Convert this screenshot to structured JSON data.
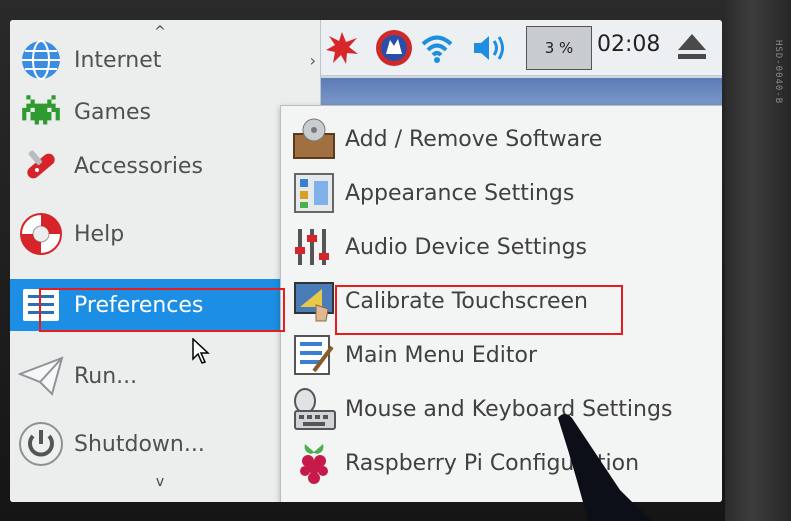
{
  "device": {
    "pcb_label": "HSD-0040-B"
  },
  "taskbar": {
    "cpu_label": "3 %",
    "clock": "02:08",
    "icons": [
      "burst-icon",
      "wolf-icon",
      "wifi-icon",
      "volume-icon",
      "eject-icon"
    ]
  },
  "main_menu": {
    "scroll_up": "^",
    "scroll_down": "v",
    "items": [
      {
        "label": "Internet",
        "icon": "globe-icon"
      },
      {
        "label": "Games",
        "icon": "space-invader-icon"
      },
      {
        "label": "Accessories",
        "icon": "knife-icon"
      },
      {
        "label": "Help",
        "icon": "lifebuoy-icon"
      },
      {
        "label": "Preferences",
        "icon": "preferences-icon"
      },
      {
        "label": "Run...",
        "icon": "paper-plane-icon"
      },
      {
        "label": "Shutdown...",
        "icon": "power-icon"
      }
    ],
    "arrow": "›"
  },
  "submenu": {
    "items": [
      {
        "label": "Add / Remove Software",
        "icon": "package-icon"
      },
      {
        "label": "Appearance Settings",
        "icon": "appearance-icon"
      },
      {
        "label": "Audio Device Settings",
        "icon": "mixer-icon"
      },
      {
        "label": "Calibrate Touchscreen",
        "icon": "touch-icon"
      },
      {
        "label": "Main Menu Editor",
        "icon": "menu-editor-icon"
      },
      {
        "label": "Mouse and Keyboard Settings",
        "icon": "keyboard-mouse-icon"
      },
      {
        "label": "Raspberry Pi Configuration",
        "icon": "raspberry-icon"
      }
    ]
  },
  "colors": {
    "selection": "#1c8fe4",
    "highlight_box": "#e51d1d"
  }
}
